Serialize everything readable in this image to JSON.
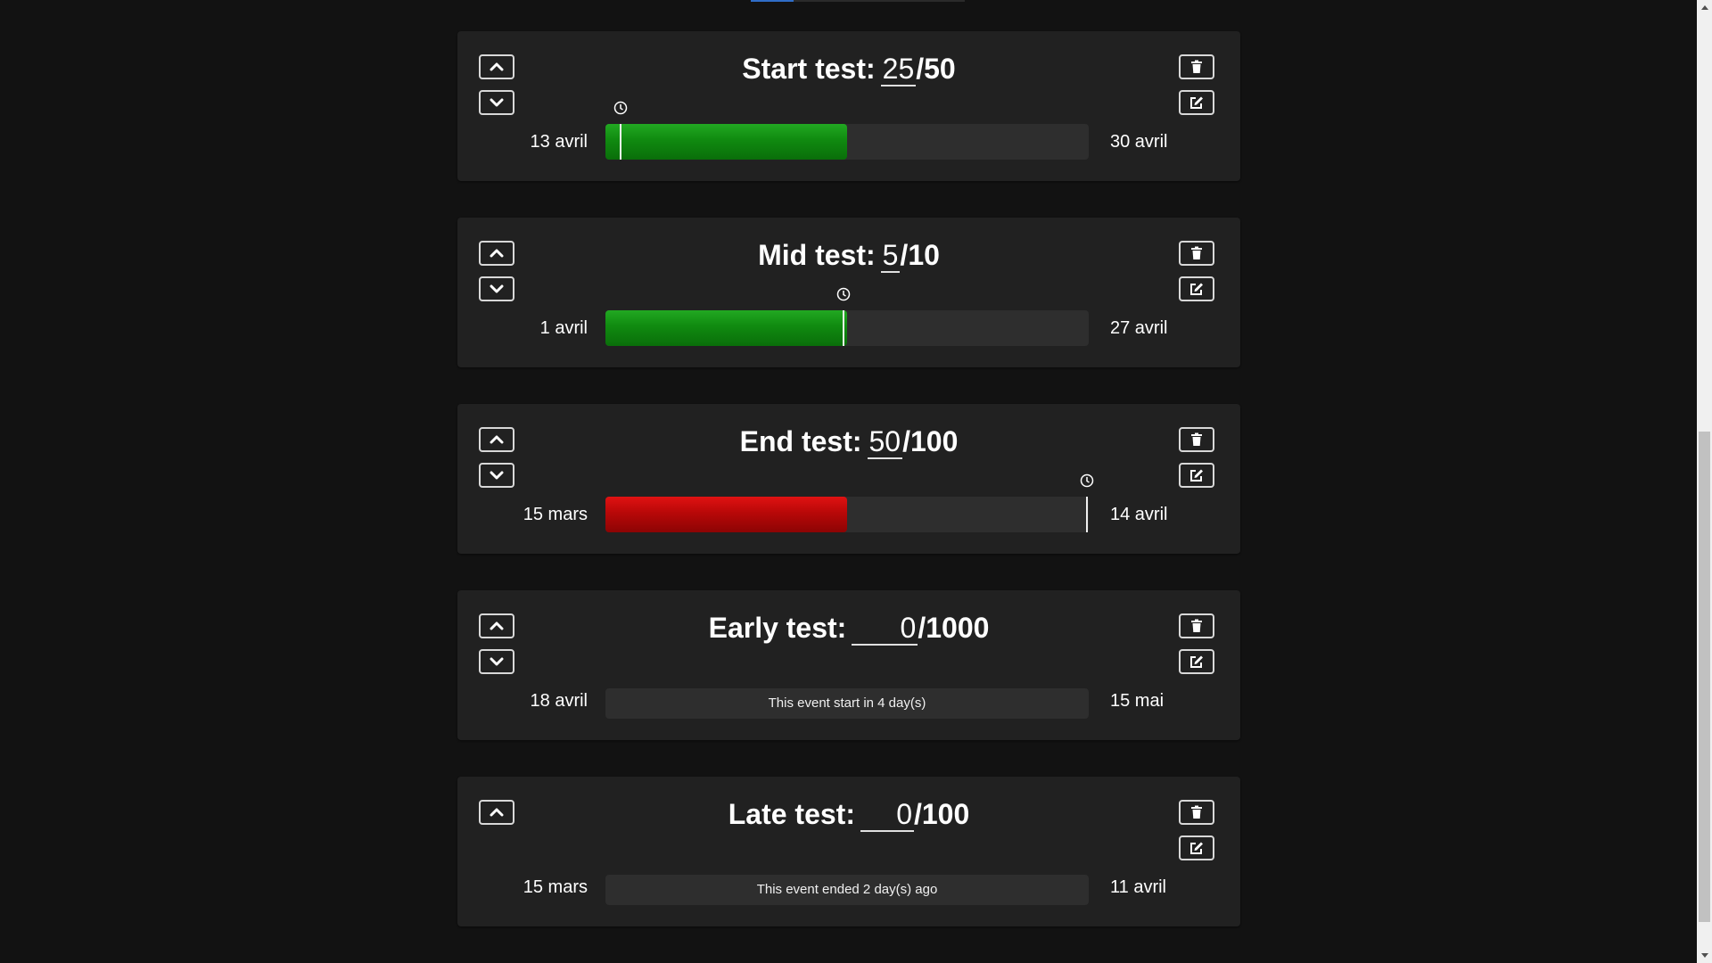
{
  "colors": {
    "page_bg": "#121212",
    "card_bg": "#212121",
    "track_bg": "#2e2e2e",
    "progress_ok": "#108a10",
    "progress_late": "#b80808"
  },
  "icons": {
    "move_up": "chevron-up-icon",
    "move_down": "chevron-down-icon",
    "delete": "trash-icon",
    "edit": "edit-icon",
    "today_marker": "clock-icon"
  },
  "events": [
    {
      "name": "Start test:",
      "score": "25",
      "separator": "/",
      "max": "50",
      "start_date": "13 avril",
      "end_date": "30 avril",
      "state": "active",
      "status_color": "green",
      "progress": 0.5,
      "today_fraction": 0.03,
      "show_up": true,
      "show_down": true
    },
    {
      "name": "Mid test:",
      "score": "5",
      "separator": "/",
      "max": "10",
      "start_date": "1 avril",
      "end_date": "27 avril",
      "state": "active",
      "status_color": "green",
      "progress": 0.5,
      "today_fraction": 0.49,
      "show_up": true,
      "show_down": true
    },
    {
      "name": "End test:",
      "score": "50",
      "separator": "/",
      "max": "100",
      "start_date": "15 mars",
      "end_date": "14 avril",
      "state": "active",
      "status_color": "red",
      "progress": 0.5,
      "today_fraction": 0.995,
      "show_up": true,
      "show_down": true
    },
    {
      "name": "Early test:",
      "score": "0",
      "separator": "/",
      "max": "1000",
      "start_date": "18 avril",
      "end_date": "15 mai",
      "state": "upcoming",
      "message": "This event start in 4 day(s)",
      "show_up": true,
      "show_down": true
    },
    {
      "name": "Late test:",
      "score": "0",
      "separator": "/",
      "max": "100",
      "start_date": "15 mars",
      "end_date": "11 avril",
      "state": "ended",
      "message": "This event ended 2 day(s) ago",
      "show_up": true,
      "show_down": false
    }
  ]
}
